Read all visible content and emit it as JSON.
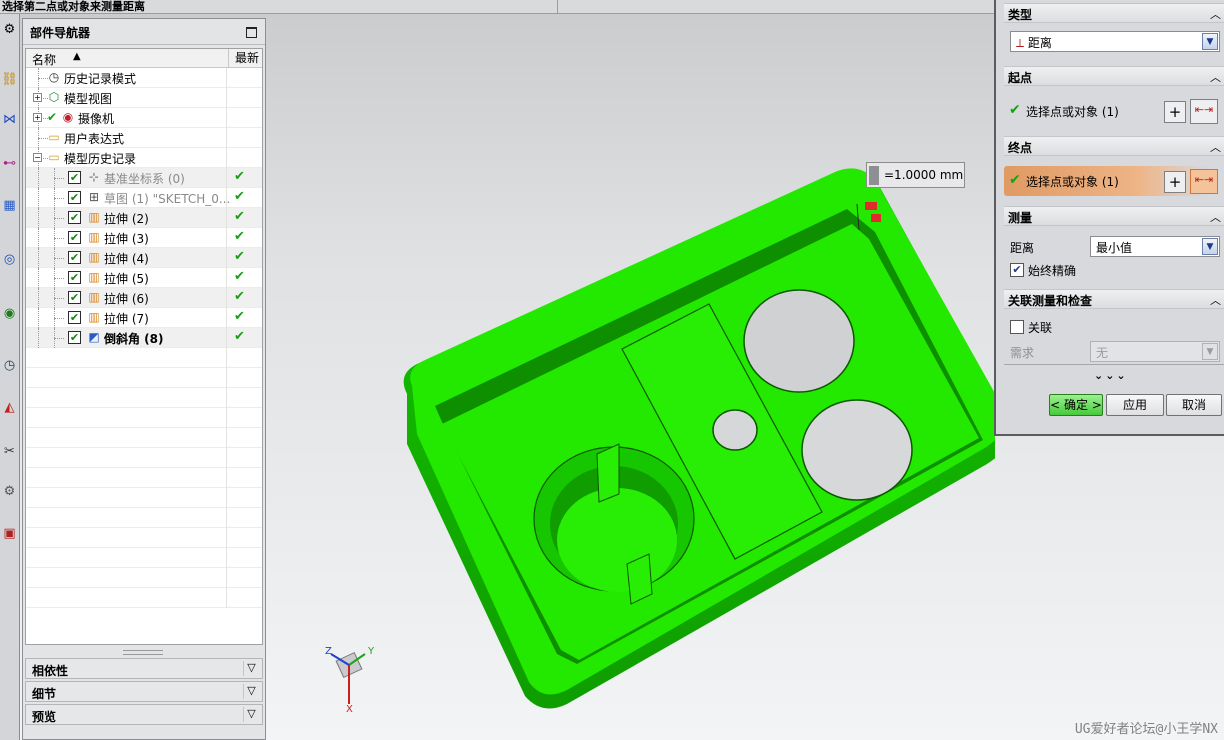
{
  "statusbar": {
    "message": "选择第二点或对象来测量距离"
  },
  "left_toolbar": {
    "icons": [
      "gear-icon",
      "assembly-icon",
      "constraint-icon",
      "graph-icon",
      "cube-icon",
      "web-icon",
      "roles-icon",
      "history-icon",
      "palette-icon",
      "tools-icon",
      "robot-icon",
      "film-icon"
    ]
  },
  "navigator": {
    "title": "部件导航器",
    "col_name": "名称",
    "col_latest": "最新",
    "items": [
      {
        "label": "历史记录模式",
        "icon": "clock-icon"
      },
      {
        "label": "模型视图",
        "icon": "model-views-icon"
      },
      {
        "label": "摄像机",
        "icon": "camera-icon"
      },
      {
        "label": "用户表达式",
        "icon": "folder-icon"
      },
      {
        "label": "模型历史记录",
        "icon": "folder-icon"
      },
      {
        "label": "基准坐标系 (0)",
        "icon": "datum-csys-icon",
        "latest": "✔"
      },
      {
        "label": "草图 (1) \"SKETCH_0...",
        "icon": "sketch-icon",
        "latest": "✔"
      },
      {
        "label": "拉伸 (2)",
        "icon": "extrude-icon",
        "latest": "✔"
      },
      {
        "label": "拉伸 (3)",
        "icon": "extrude-icon",
        "latest": "✔"
      },
      {
        "label": "拉伸 (4)",
        "icon": "extrude-icon",
        "latest": "✔"
      },
      {
        "label": "拉伸 (5)",
        "icon": "extrude-icon",
        "latest": "✔"
      },
      {
        "label": "拉伸 (6)",
        "icon": "extrude-icon",
        "latest": "✔"
      },
      {
        "label": "拉伸 (7)",
        "icon": "extrude-icon",
        "latest": "✔"
      },
      {
        "label": "倒斜角 (8)",
        "icon": "chamfer-icon",
        "latest": "✔"
      }
    ],
    "panels": [
      "相依性",
      "细节",
      "预览"
    ]
  },
  "viewport": {
    "measurement_label": "=1.0000 mm",
    "triad": {
      "z": "Z",
      "y": "Y",
      "x": "X"
    },
    "watermark": "UG爱好者论坛@小王学NX",
    "part_color": "#23e900"
  },
  "dialog": {
    "type_section": "类型",
    "type_value": "距离",
    "start_section": "起点",
    "start_select": "选择点或对象 (1)",
    "end_section": "终点",
    "end_select": "选择点或对象 (1)",
    "measure_section": "测量",
    "distance_label": "距离",
    "distance_value": "最小值",
    "always_precise_label": "始终精确",
    "always_precise_checked": true,
    "assoc_section": "关联测量和检查",
    "assoc_label": "关联",
    "assoc_checked": false,
    "requirement_label": "需求",
    "requirement_value": "无",
    "ok_label": "< 确定 >",
    "apply_label": "应用",
    "cancel_label": "取消",
    "more_glyph": "⌄⌄⌄"
  }
}
